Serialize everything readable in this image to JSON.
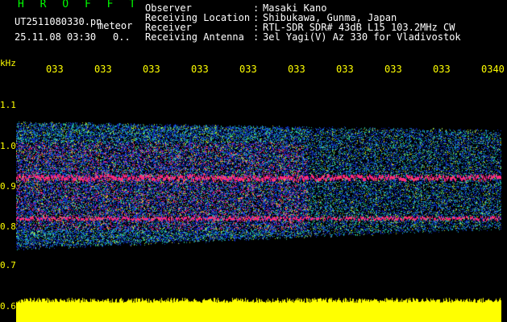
{
  "header": {
    "app_title": "H R O F F T",
    "file_name": "UT2511080330.pn",
    "meteor_label": "meteor",
    "datetime": "25.11.08 03:30",
    "counter": "0.."
  },
  "station_info": [
    {
      "key": "Observer",
      "sep": ":",
      "value": "Masaki Kano"
    },
    {
      "key": "Receiving Location",
      "sep": ":",
      "value": "Shibukawa, Gunma, Japan"
    },
    {
      "key": "Receiver",
      "sep": ":",
      "value": "RTL-SDR SDR# 43dB L15 103.2MHz CW"
    },
    {
      "key": "Receiving Antenna",
      "sep": ":",
      "value": "3el Yagi(V) Az 330 for Vladivostok"
    }
  ],
  "axis": {
    "y_unit": "kHz",
    "y_ticks": [
      "1.1",
      "1.0",
      "0.9",
      "0.8",
      "0.7",
      "0.6"
    ],
    "x_ticks": [
      "033",
      "033",
      "033",
      "033",
      "033",
      "033",
      "033",
      "033",
      "033",
      "0340"
    ]
  },
  "colors": {
    "background": "#000000",
    "label_yellow": "#ffff00",
    "title_green": "#00ff00",
    "signal_hot": "#ff2a7a",
    "noise_low": "#1030d0",
    "noise_mid": "#20c0a0",
    "noise_high": "#d0e020",
    "noise_floor": "#ffff00"
  }
}
